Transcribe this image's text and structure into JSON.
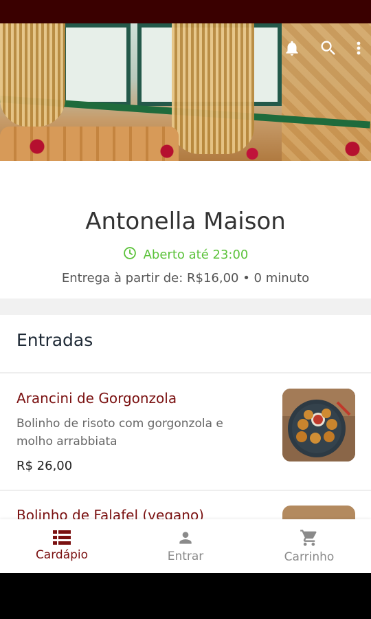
{
  "restaurant": {
    "name": "Antonella Maison",
    "open_text": "Aberto até 23:00",
    "delivery_text": "Entrega à partir de: R$16,00 • 0 minuto"
  },
  "colors": {
    "status_bar": "#3a0000",
    "accent": "#7a1010",
    "open": "#5bc23a"
  },
  "header_icons": [
    "bell-icon",
    "search-icon",
    "more-vert-icon"
  ],
  "menu": {
    "category": "Entradas",
    "items": [
      {
        "name": "Arancini de Gorgonzola",
        "description": "Bolinho de risoto com gorgonzola e molho arrabbiata",
        "price": "R$ 26,00"
      },
      {
        "name": "Bolinho de Falafel (vegano)"
      }
    ]
  },
  "nav": {
    "items": [
      {
        "label": "Cardápio",
        "icon": "list-icon",
        "active": true
      },
      {
        "label": "Entrar",
        "icon": "person-icon",
        "active": false
      },
      {
        "label": "Carrinho",
        "icon": "cart-icon",
        "active": false
      }
    ]
  }
}
